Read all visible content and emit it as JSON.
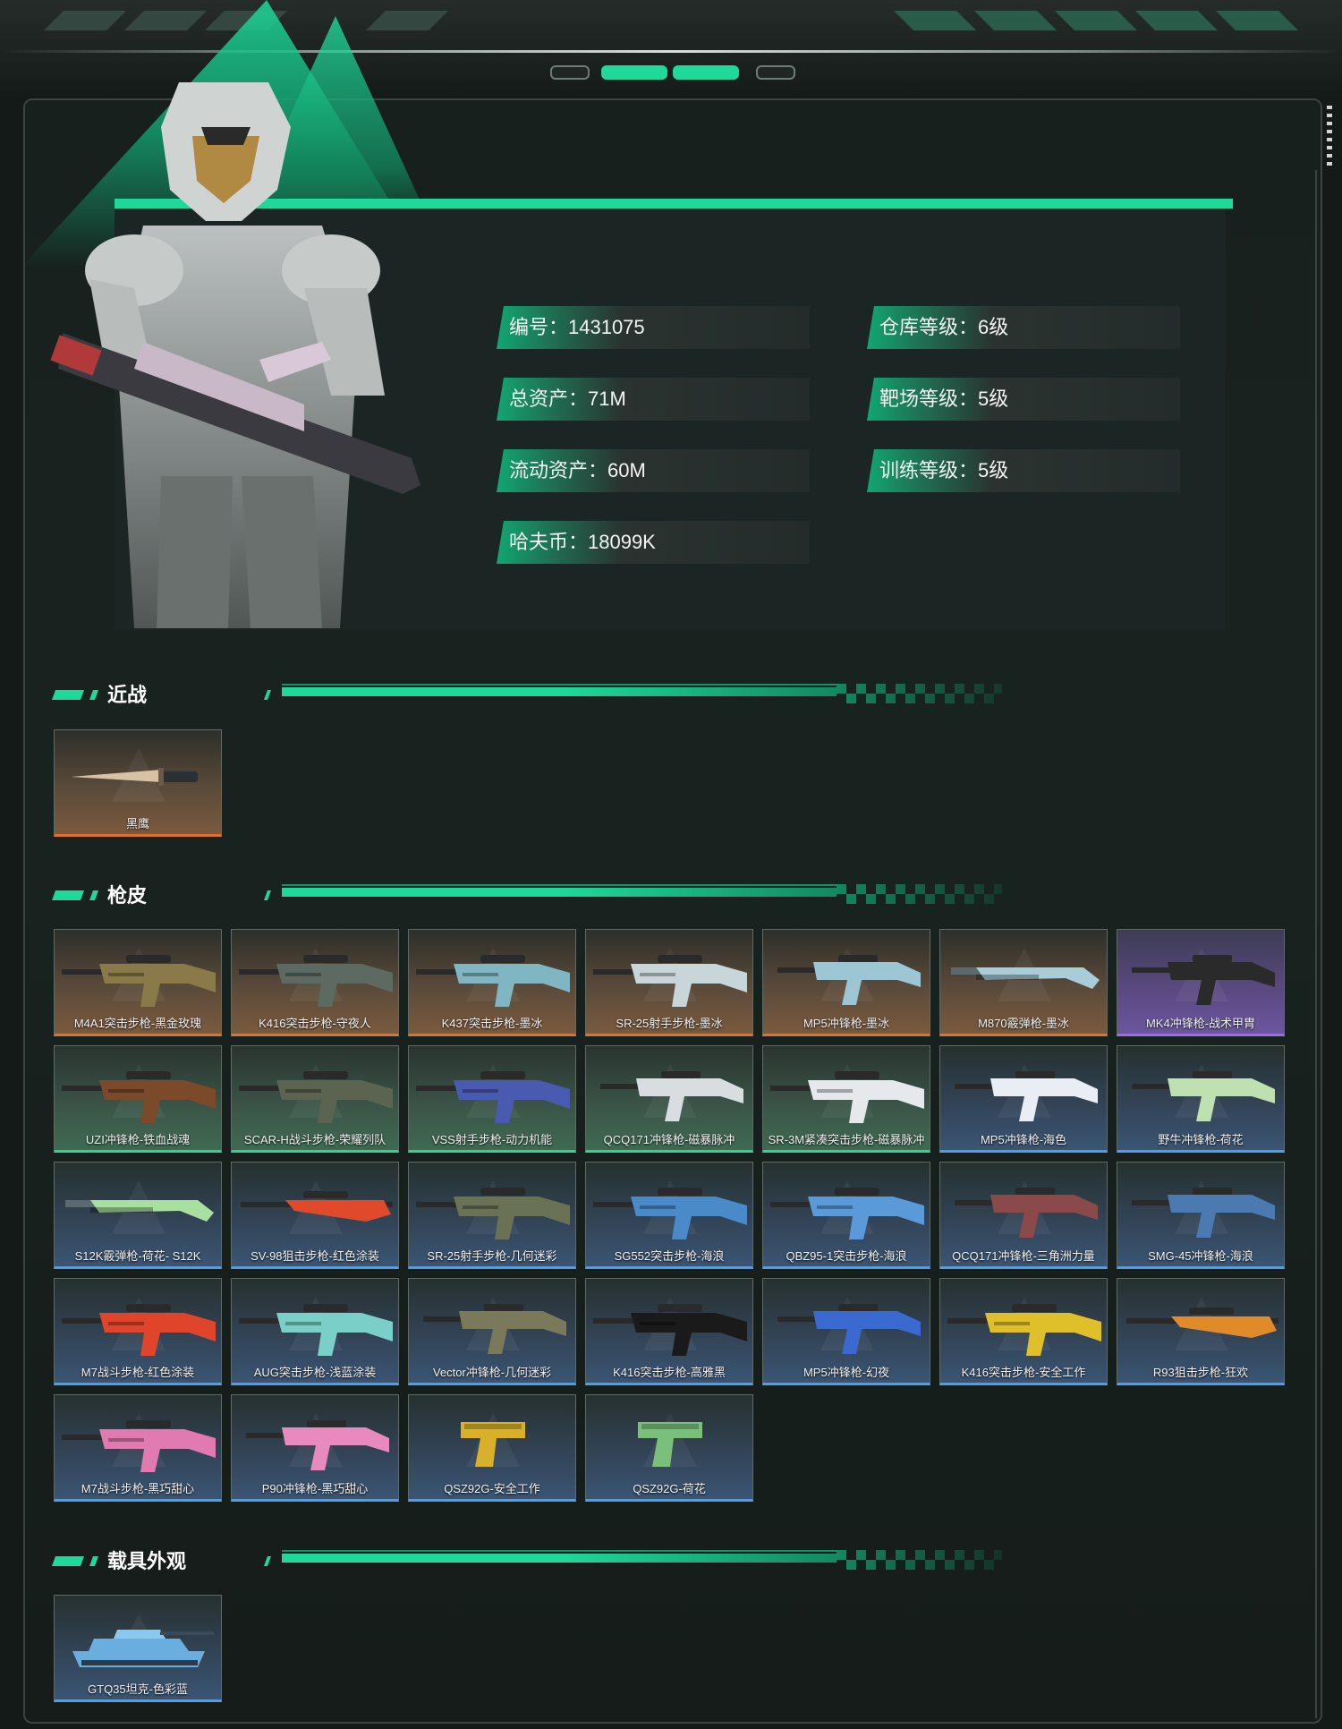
{
  "profile": {
    "stats": [
      {
        "key": "编号",
        "value": "1431075"
      },
      {
        "key": "仓库等级",
        "value": "6级"
      },
      {
        "key": "总资产",
        "value": "71M"
      },
      {
        "key": "靶场等级",
        "value": "5级"
      },
      {
        "key": "流动资产",
        "value": "60M"
      },
      {
        "key": "训练等级",
        "value": "5级"
      },
      {
        "key": "哈夫币",
        "value": "18099K"
      }
    ],
    "stat_lines": [
      "编号：1431075",
      "仓库等级：6级",
      "总资产：71M",
      "靶场等级：5级",
      "流动资产：60M",
      "训练等级：5级",
      "哈夫币：18099K"
    ]
  },
  "sections": {
    "melee": {
      "title": "近战",
      "items": [
        {
          "name": "黑鹰",
          "rarity": "orange",
          "icon": "knife-icon"
        }
      ]
    },
    "skins": {
      "title": "枪皮",
      "items": [
        {
          "name": "M4A1突击步枪-黑金玫瑰",
          "rarity": "orange",
          "icon": "rifle-icon",
          "color": "#8a7a4a"
        },
        {
          "name": "K416突击步枪-守夜人",
          "rarity": "orange",
          "icon": "rifle-icon",
          "color": "#5d6a62"
        },
        {
          "name": "K437突击步枪-墨冰",
          "rarity": "orange",
          "icon": "rifle-icon",
          "color": "#7fb6c2"
        },
        {
          "name": "SR-25射手步枪-墨冰",
          "rarity": "orange",
          "icon": "rifle-icon",
          "color": "#c8d6da"
        },
        {
          "name": "MP5冲锋枪-墨冰",
          "rarity": "orange",
          "icon": "smg-icon",
          "color": "#9cc6d4"
        },
        {
          "name": "M870霰弹枪-墨冰",
          "rarity": "orange",
          "icon": "shotgun-icon",
          "color": "#a8cdd8"
        },
        {
          "name": "MK4冲锋枪-战术甲胄",
          "rarity": "purple",
          "icon": "smg-icon",
          "color": "#2a2a2a"
        },
        {
          "name": "UZI冲锋枪-铁血战魂",
          "rarity": "green",
          "icon": "rifle-icon",
          "color": "#7a4a2a"
        },
        {
          "name": "SCAR-H战斗步枪-荣耀列队",
          "rarity": "green",
          "icon": "rifle-icon",
          "color": "#5a6450"
        },
        {
          "name": "VSS射手步枪-动力机能",
          "rarity": "green",
          "icon": "rifle-icon",
          "color": "#4a5ab0"
        },
        {
          "name": "QCQ171冲锋枪-磁暴脉冲",
          "rarity": "green",
          "icon": "smg-icon",
          "color": "#d8dde0"
        },
        {
          "name": "SR-3M紧凑突击步枪-磁暴脉冲",
          "rarity": "green",
          "icon": "rifle-icon",
          "color": "#e6e9ec"
        },
        {
          "name": "MP5冲锋枪-海色",
          "rarity": "blue",
          "icon": "smg-icon",
          "color": "#e8eef4"
        },
        {
          "name": "野牛冲锋枪-荷花",
          "rarity": "blue",
          "icon": "smg-icon",
          "color": "#bfe0b0"
        },
        {
          "name": "S12K霰弹枪-荷花- S12K",
          "rarity": "blue",
          "icon": "shotgun-icon",
          "color": "#a8e0a0"
        },
        {
          "name": "SV-98狙击步枪-红色涂装",
          "rarity": "blue",
          "icon": "sniper-icon",
          "color": "#e04a2a"
        },
        {
          "name": "SR-25射手步枪-几何迷彩",
          "rarity": "blue",
          "icon": "rifle-icon",
          "color": "#6a7256"
        },
        {
          "name": "SG552突击步枪-海浪",
          "rarity": "blue",
          "icon": "rifle-icon",
          "color": "#4a8ac8"
        },
        {
          "name": "QBZ95-1突击步枪-海浪",
          "rarity": "blue",
          "icon": "rifle-icon",
          "color": "#5a9ad8"
        },
        {
          "name": "QCQ171冲锋枪-三角洲力量",
          "rarity": "blue",
          "icon": "smg-icon",
          "color": "#8a4a4a"
        },
        {
          "name": "SMG-45冲锋枪-海浪",
          "rarity": "blue",
          "icon": "smg-icon",
          "color": "#4a7ab0"
        },
        {
          "name": "M7战斗步枪-红色涂装",
          "rarity": "blue",
          "icon": "rifle-icon",
          "color": "#e0442a"
        },
        {
          "name": "AUG突击步枪-浅蓝涂装",
          "rarity": "blue",
          "icon": "rifle-icon",
          "color": "#7ad0c8"
        },
        {
          "name": "Vector冲锋枪-几何迷彩",
          "rarity": "blue",
          "icon": "smg-icon",
          "color": "#7a7a5a"
        },
        {
          "name": "K416突击步枪-高雅黑",
          "rarity": "blue",
          "icon": "rifle-icon",
          "color": "#1a1a1a"
        },
        {
          "name": "MP5冲锋枪-幻夜",
          "rarity": "blue",
          "icon": "smg-icon",
          "color": "#3a6ad0"
        },
        {
          "name": "K416突击步枪-安全工作",
          "rarity": "blue",
          "icon": "rifle-icon",
          "color": "#e0c02a"
        },
        {
          "name": "R93狙击步枪-狂欢",
          "rarity": "blue",
          "icon": "sniper-icon",
          "color": "#e08a2a"
        },
        {
          "name": "M7战斗步枪-黑巧甜心",
          "rarity": "blue",
          "icon": "rifle-icon",
          "color": "#e07ab0"
        },
        {
          "name": "P90冲锋枪-黑巧甜心",
          "rarity": "blue",
          "icon": "smg-icon",
          "color": "#e88ac0"
        },
        {
          "name": "QSZ92G-安全工作",
          "rarity": "blue",
          "icon": "pistol-icon",
          "color": "#d8b02a"
        },
        {
          "name": "QSZ92G-荷花",
          "rarity": "blue",
          "icon": "pistol-icon",
          "color": "#7ac07a"
        }
      ]
    },
    "vehicles": {
      "title": "载具外观",
      "items": [
        {
          "name": "GTQ35坦克-色彩蓝",
          "rarity": "blue",
          "icon": "tank-icon",
          "color": "#6aaee0"
        }
      ]
    }
  },
  "colors": {
    "accent": "#1fd99a",
    "rarity_orange": "#e0702a",
    "rarity_purple": "#9d6ae8",
    "rarity_green": "#2bd690",
    "rarity_blue": "#4aa0ee"
  }
}
